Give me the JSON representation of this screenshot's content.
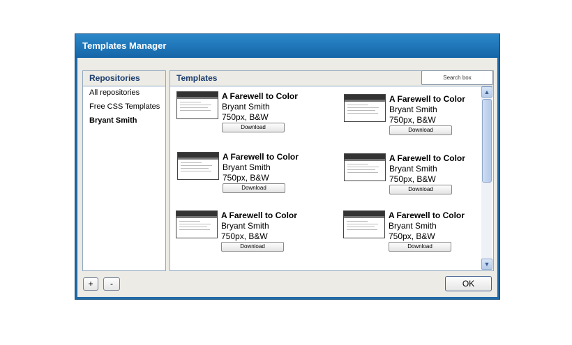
{
  "window": {
    "title": "Templates Manager"
  },
  "repositories": {
    "header": "Repositories",
    "items": [
      {
        "label": "All repositories",
        "selected": false
      },
      {
        "label": "Free CSS Templates",
        "selected": false
      },
      {
        "label": "Bryant Smith",
        "selected": true
      }
    ]
  },
  "templates": {
    "header": "Templates",
    "search_label": "Search box",
    "items": [
      {
        "title": "A Farewell to Color",
        "author": "Bryant Smith",
        "spec": "750px, B&W",
        "button": "Download"
      },
      {
        "title": "A Farewell to Color",
        "author": "Bryant Smith",
        "spec": "750px, B&W",
        "button": "Download"
      },
      {
        "title": "A Farewell to Color",
        "author": "Bryant Smith",
        "spec": "750px, B&W",
        "button": "Download"
      },
      {
        "title": "A Farewell to Color",
        "author": "Bryant Smith",
        "spec": "750px, B&W",
        "button": "Download"
      },
      {
        "title": "A Farewell to Color",
        "author": "Bryant Smith",
        "spec": "750px, B&W",
        "button": "Download"
      },
      {
        "title": "A Farewell to Color",
        "author": "Bryant Smith",
        "spec": "750px, B&W",
        "button": "Download"
      }
    ],
    "thumbnail_caption": "A Farewell to Color"
  },
  "footer": {
    "add_label": "+",
    "remove_label": "-",
    "ok_label": "OK"
  },
  "icons": {
    "scroll_up": "chevron-up-icon",
    "scroll_down": "chevron-down-icon"
  },
  "colors": {
    "title_bar": "#1f6aa6",
    "panel_border": "#8fa7c0",
    "header_text": "#1b3d6e"
  }
}
